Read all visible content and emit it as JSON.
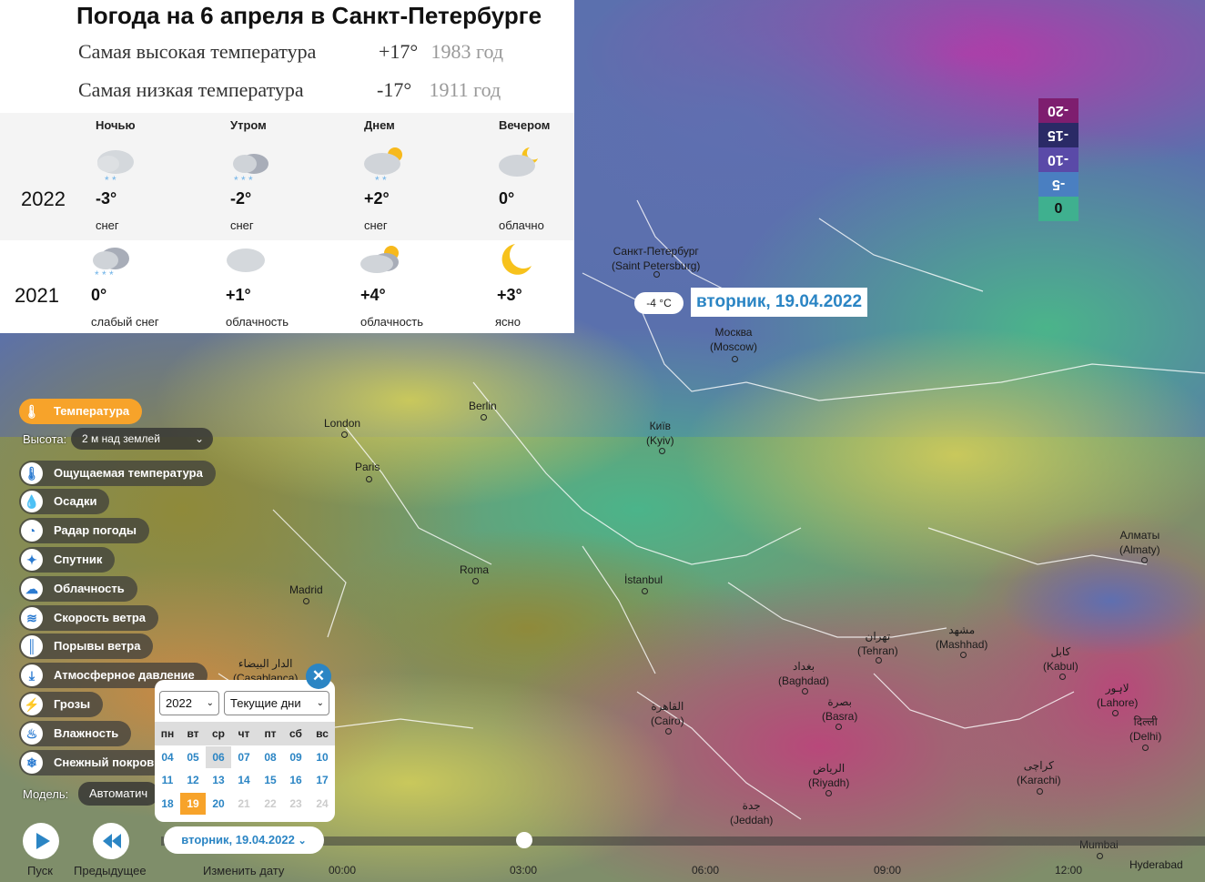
{
  "header": {
    "title": "Погода на 6 апреля в Санкт-Петербурге",
    "records": {
      "high": {
        "label": "Самая высокая температура",
        "value": "+17°",
        "year": "1983 год"
      },
      "low": {
        "label": "Самая низкая температура",
        "value": "-17°",
        "year": "1911 год"
      }
    }
  },
  "periods": [
    "Ночью",
    "Утром",
    "Днем",
    "Вечером"
  ],
  "years": [
    {
      "year": "2022",
      "cells": [
        {
          "temp": "-3°",
          "desc": "снег",
          "icon": "cloud-snow-icon"
        },
        {
          "temp": "-2°",
          "desc": "снег",
          "icon": "cloud-snow-icon"
        },
        {
          "temp": "+2°",
          "desc": "снег",
          "icon": "sun-cloud-snow-icon"
        },
        {
          "temp": "0°",
          "desc": "облачно",
          "icon": "moon-cloud-icon"
        }
      ]
    },
    {
      "year": "2021",
      "cells": [
        {
          "temp": "0°",
          "desc": "слабый снег",
          "icon": "cloud-snow-icon"
        },
        {
          "temp": "+1°",
          "desc": "облачность",
          "icon": "cloud-icon"
        },
        {
          "temp": "+4°",
          "desc": "облачность",
          "icon": "sun-cloud-icon"
        },
        {
          "temp": "+3°",
          "desc": "ясно",
          "icon": "moon-icon"
        }
      ]
    }
  ],
  "layers": {
    "active": "Температура",
    "height_label": "Высота:",
    "height_value": "2 м над землей",
    "items": [
      "Ощущаемая температура",
      "Осадки",
      "Радар погоды",
      "Спутник",
      "Облачность",
      "Скорость ветра",
      "Порывы ветра",
      "Атмосферное давление",
      "Грозы",
      "Влажность",
      "Снежный покров"
    ],
    "model_label": "Модель:",
    "model_value": "Автоматич"
  },
  "legend": [
    "-20",
    "-15",
    "-10",
    "-5",
    "0"
  ],
  "map": {
    "temp_bubble": "-4 °C",
    "date_label": "вторник, 19.04.2022",
    "cities": [
      {
        "name": "Санкт-Петербург",
        "sub": "(Saint Petersburg)"
      },
      {
        "name": "Москва",
        "sub": "(Moscow)"
      },
      {
        "name": "Berlin",
        "sub": ""
      },
      {
        "name": "London",
        "sub": ""
      },
      {
        "name": "Paris",
        "sub": ""
      },
      {
        "name": "Київ",
        "sub": "(Kyiv)"
      },
      {
        "name": "Roma",
        "sub": ""
      },
      {
        "name": "İstanbul",
        "sub": ""
      },
      {
        "name": "Madrid",
        "sub": ""
      },
      {
        "name": "الدار البيضاء",
        "sub": "(Casablanca)"
      },
      {
        "name": "القاهرة",
        "sub": "(Cairo)"
      },
      {
        "name": "تهران",
        "sub": "(Tehran)"
      },
      {
        "name": "مشهد",
        "sub": "(Mashhad)"
      },
      {
        "name": "بغداد",
        "sub": "(Baghdad)"
      },
      {
        "name": "بصرة",
        "sub": "(Basra)"
      },
      {
        "name": "الرياض",
        "sub": "(Riyadh)"
      },
      {
        "name": "جدة",
        "sub": "(Jeddah)"
      },
      {
        "name": "کابل",
        "sub": "(Kabul)"
      },
      {
        "name": "لاہور",
        "sub": "(Lahore)"
      },
      {
        "name": "کراچی",
        "sub": "(Karachi)"
      },
      {
        "name": "दिल्ली",
        "sub": "(Delhi)"
      },
      {
        "name": "Алматы",
        "sub": "(Almaty)"
      },
      {
        "name": "Mumbai",
        "sub": ""
      },
      {
        "name": "Hyderabad",
        "sub": ""
      }
    ]
  },
  "calendar": {
    "year": "2022",
    "range": "Текущие дни",
    "weekdays": [
      "пн",
      "вт",
      "ср",
      "чт",
      "пт",
      "сб",
      "вс"
    ],
    "weeks": [
      [
        "04",
        "05",
        "06",
        "07",
        "08",
        "09",
        "10"
      ],
      [
        "11",
        "12",
        "13",
        "14",
        "15",
        "16",
        "17"
      ],
      [
        "18",
        "19",
        "20",
        "21",
        "22",
        "23",
        "24"
      ]
    ],
    "today": "06",
    "selected": "19"
  },
  "controls": {
    "play": "Пуск",
    "prev": "Предыдущее",
    "change_date": "Изменить дату",
    "date_pill": "вторник, 19.04.2022",
    "hours": [
      "00:00",
      "03:00",
      "06:00",
      "09:00",
      "12:00"
    ]
  }
}
